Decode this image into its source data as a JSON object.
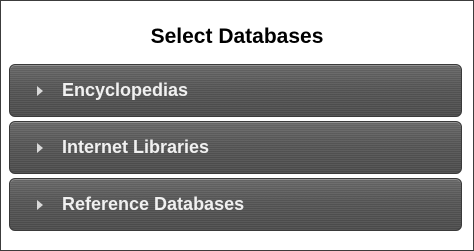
{
  "panel": {
    "title": "Select Databases"
  },
  "accordion": {
    "items": [
      {
        "label": "Encyclopedias",
        "icon": "chevron-right-icon"
      },
      {
        "label": "Internet Libraries",
        "icon": "chevron-right-icon"
      },
      {
        "label": "Reference Databases",
        "icon": "chevron-right-icon"
      }
    ]
  }
}
